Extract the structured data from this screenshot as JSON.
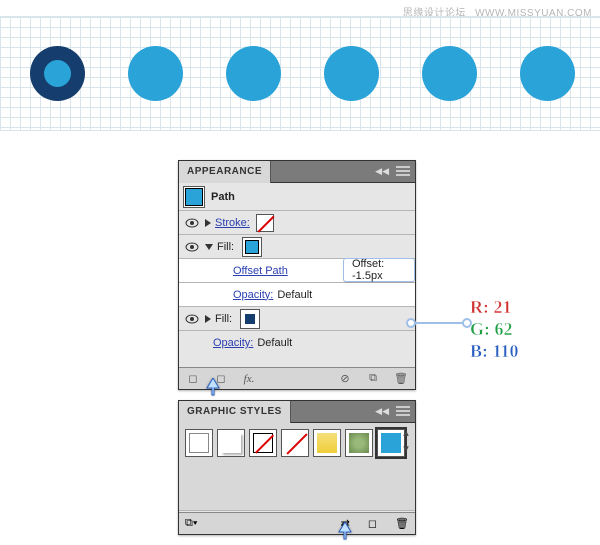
{
  "watermark": {
    "cn": "思缘设计论坛",
    "url": "WWW.MISSYUAN.COM"
  },
  "appearance": {
    "title": "APPEARANCE",
    "path_label": "Path",
    "stroke_label": "Stroke:",
    "fill_label": "Fill:",
    "offset_path_label": "Offset Path",
    "offset_tooltip": "Offset: -1.5px",
    "opacity_label": "Opacity:",
    "opacity_value": "Default",
    "fx_label": "fx."
  },
  "styles": {
    "title": "GRAPHIC STYLES"
  },
  "rgb": {
    "r_label": "R:",
    "r_value": "21",
    "g_label": "G:",
    "g_value": "62",
    "b_label": "B:",
    "b_value": "110"
  },
  "colors": {
    "cyan": "#2aa3d8",
    "navy": "#153e6e"
  }
}
